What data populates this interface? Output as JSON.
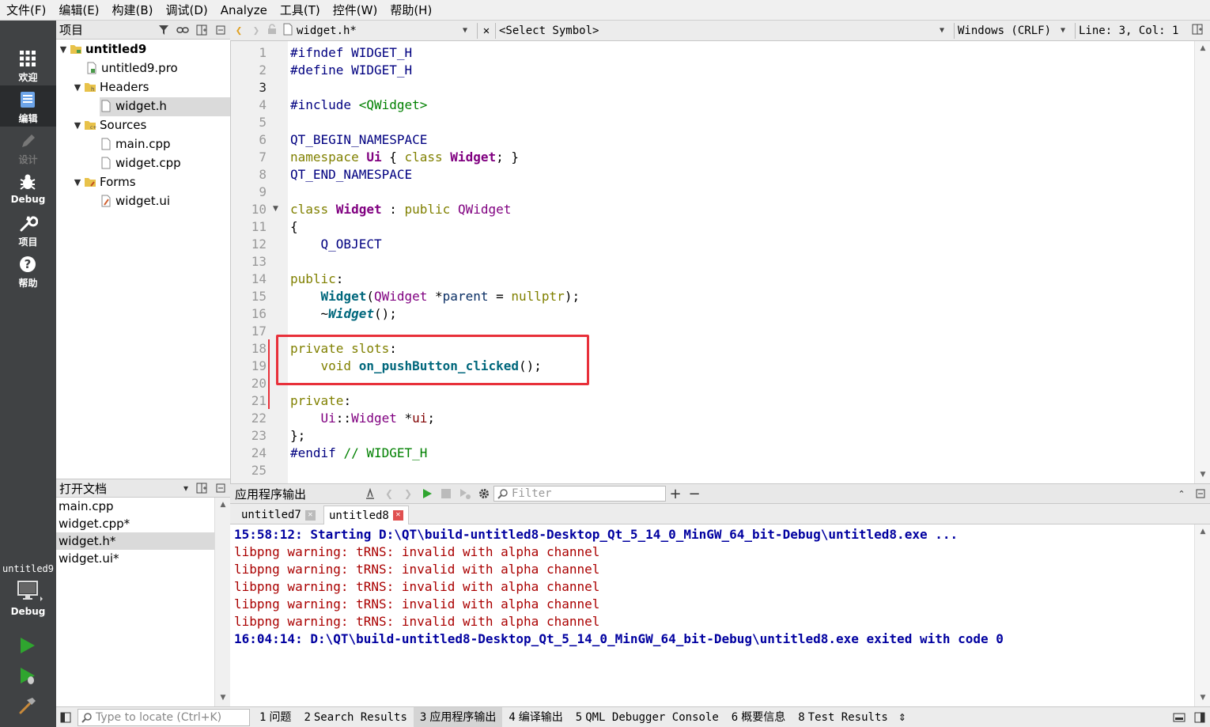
{
  "menu": [
    "文件(F)",
    "编辑(E)",
    "构建(B)",
    "调试(D)",
    "Analyze",
    "工具(T)",
    "控件(W)",
    "帮助(H)"
  ],
  "modes": [
    {
      "label": "欢迎",
      "icon": "grid-icon"
    },
    {
      "label": "编辑",
      "icon": "document-icon"
    },
    {
      "label": "设计",
      "icon": "pencil-icon"
    },
    {
      "label": "Debug",
      "icon": "bug-icon"
    },
    {
      "label": "项目",
      "icon": "wrench-icon"
    },
    {
      "label": "帮助",
      "icon": "help-icon"
    }
  ],
  "kit": {
    "project": "untitled9",
    "mode": "Debug"
  },
  "project_panel": {
    "title": "项目",
    "tree": {
      "root": "untitled9",
      "pro_file": "untitled9.pro",
      "headers": "Headers",
      "header_files": [
        "widget.h"
      ],
      "sources": "Sources",
      "source_files": [
        "main.cpp",
        "widget.cpp"
      ],
      "forms": "Forms",
      "form_files": [
        "widget.ui"
      ]
    }
  },
  "open_documents": {
    "title": "打开文档",
    "items": [
      "main.cpp",
      "widget.cpp*",
      "widget.h*",
      "widget.ui*"
    ],
    "selected": "widget.h*"
  },
  "editor_toolbar": {
    "file": "widget.h*",
    "symbol": "<Select Symbol>",
    "line_ending": "Windows (CRLF)",
    "position": "Line: 3, Col: 1"
  },
  "editor": {
    "current_line": 3,
    "lines": [
      "1",
      "2",
      "3",
      "4",
      "5",
      "6",
      "7",
      "8",
      "9",
      "10",
      "11",
      "12",
      "13",
      "14",
      "15",
      "16",
      "17",
      "18",
      "19",
      "20",
      "21",
      "22",
      "23",
      "24",
      "25"
    ],
    "code": {
      "l1": "#ifndef WIDGET_H",
      "l2": "#define WIDGET_H",
      "l4a": "#include ",
      "l4b": "<QWidget>",
      "l6": "QT_BEGIN_NAMESPACE",
      "l7a": "namespace ",
      "l7b": "Ui",
      "l7c": " { ",
      "l7d": "class ",
      "l7e": "Widget",
      "l7f": "; }",
      "l8": "QT_END_NAMESPACE",
      "l10a": "class ",
      "l10b": "Widget",
      "l10c": " : ",
      "l10d": "public ",
      "l10e": "QWidget",
      "l11": "{",
      "l12": "    Q_OBJECT",
      "l14a": "public",
      "l14b": ":",
      "l15a": "    ",
      "l15b": "Widget",
      "l15c": "(",
      "l15d": "QWidget",
      "l15e": " *",
      "l15f": "parent",
      "l15g": " = ",
      "l15h": "nullptr",
      "l15i": ");",
      "l16a": "    ~",
      "l16b": "Widget",
      "l16c": "();",
      "l18a": "private ",
      "l18b": "slots",
      "l18c": ":",
      "l19a": "    ",
      "l19b": "void ",
      "l19c": "on_pushButton_clicked",
      "l19d": "();",
      "l21a": "private",
      "l21b": ":",
      "l22a": "    ",
      "l22b": "Ui",
      "l22c": "::",
      "l22d": "Widget",
      "l22e": " *",
      "l22f": "ui",
      "l22g": ";",
      "l23": "};",
      "l24a": "#endif ",
      "l24b": "// WIDGET_H"
    }
  },
  "output": {
    "title": "应用程序输出",
    "filter_placeholder": "Filter",
    "tabs": [
      "untitled7",
      "untitled8"
    ],
    "active_tab": "untitled8",
    "lines": [
      {
        "kind": "info",
        "text": "15:58:12: Starting D:\\QT\\build-untitled8-Desktop_Qt_5_14_0_MinGW_64_bit-Debug\\untitled8.exe ..."
      },
      {
        "kind": "err",
        "text": "libpng warning: tRNS: invalid with alpha channel"
      },
      {
        "kind": "err",
        "text": "libpng warning: tRNS: invalid with alpha channel"
      },
      {
        "kind": "err",
        "text": "libpng warning: tRNS: invalid with alpha channel"
      },
      {
        "kind": "err",
        "text": "libpng warning: tRNS: invalid with alpha channel"
      },
      {
        "kind": "err",
        "text": "libpng warning: tRNS: invalid with alpha channel"
      },
      {
        "kind": "info",
        "text": "16:04:14: D:\\QT\\build-untitled8-Desktop_Qt_5_14_0_MinGW_64_bit-Debug\\untitled8.exe exited with code 0"
      }
    ]
  },
  "statusbar": {
    "locator_placeholder": "Type to locate (Ctrl+K)",
    "panes": [
      {
        "num": "1",
        "label": "问题"
      },
      {
        "num": "2",
        "label": "Search Results"
      },
      {
        "num": "3",
        "label": "应用程序输出"
      },
      {
        "num": "4",
        "label": "编译输出"
      },
      {
        "num": "5",
        "label": "QML Debugger Console"
      },
      {
        "num": "6",
        "label": "概要信息"
      },
      {
        "num": "8",
        "label": "Test Results"
      }
    ],
    "active_pane": "3"
  },
  "colors": {
    "highlight_box": "#e8303a",
    "run_green": "#2fa52f",
    "modebar": "#404244"
  }
}
